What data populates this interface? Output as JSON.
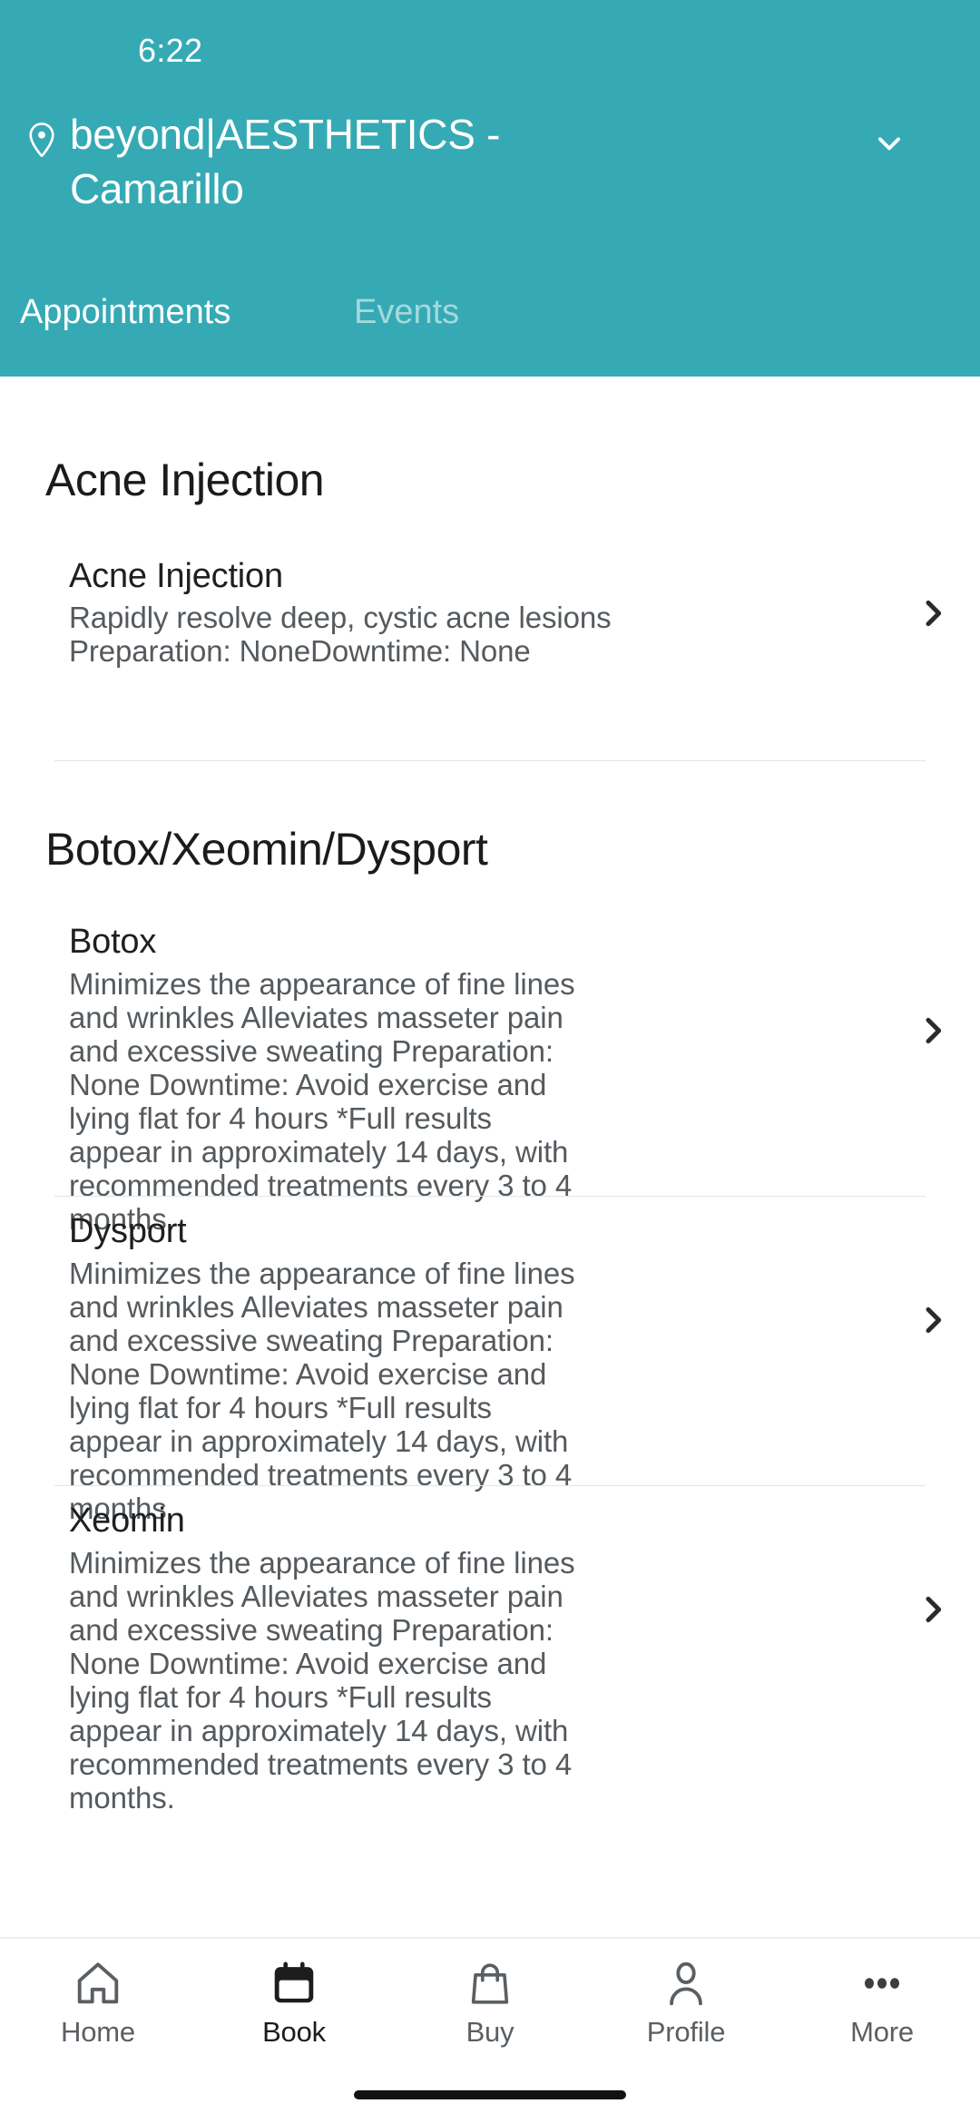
{
  "status_bar": {
    "time": "6:22"
  },
  "header": {
    "background_color": "#35AAB4",
    "location_icon": "map-pin-icon",
    "salon_name": "beyond|AESTHETICS - Camarillo",
    "dropdown_icon": "chevron-down-icon",
    "tabs": [
      {
        "label": "Appointments",
        "active": true
      },
      {
        "label": "Events",
        "active": false
      }
    ]
  },
  "sections": [
    {
      "title": "Acne Injection",
      "items": [
        {
          "title": "Acne Injection",
          "description": "Rapidly resolve deep, cystic acne lesions Preparation: NoneDowntime: None",
          "chevron": "chevron-right-icon"
        }
      ]
    },
    {
      "title": "Botox/Xeomin/Dysport",
      "items": [
        {
          "title": "Botox",
          "description": "Minimizes the appearance of fine lines and wrinkles Alleviates masseter pain and excessive sweating Preparation: None Downtime: Avoid exercise and lying flat for 4 hours *Full results appear in approximately 14 days, with recommended treatments every 3 to 4 months.",
          "chevron": "chevron-right-icon"
        },
        {
          "title": "Dysport",
          "description": "Minimizes the appearance of fine lines and wrinkles Alleviates masseter pain and excessive sweating Preparation: None Downtime: Avoid exercise and lying flat for 4 hours *Full results appear in approximately 14 days, with recommended treatments every 3 to 4 months.",
          "chevron": "chevron-right-icon"
        },
        {
          "title": "Xeomin",
          "description": "Minimizes the appearance of fine lines and wrinkles Alleviates masseter pain and excessive sweating Preparation: None Downtime: Avoid exercise and lying flat for 4 hours *Full results appear in approximately 14 days, with recommended treatments every 3 to 4 months.",
          "chevron": "chevron-right-icon"
        }
      ]
    }
  ],
  "bottom_nav": {
    "items": [
      {
        "label": "Home",
        "icon": "home-icon",
        "active": false
      },
      {
        "label": "Book",
        "icon": "calendar-icon",
        "active": true
      },
      {
        "label": "Buy",
        "icon": "bag-icon",
        "active": false
      },
      {
        "label": "Profile",
        "icon": "person-icon",
        "active": false
      },
      {
        "label": "More",
        "icon": "ellipsis-icon",
        "active": false
      }
    ]
  }
}
